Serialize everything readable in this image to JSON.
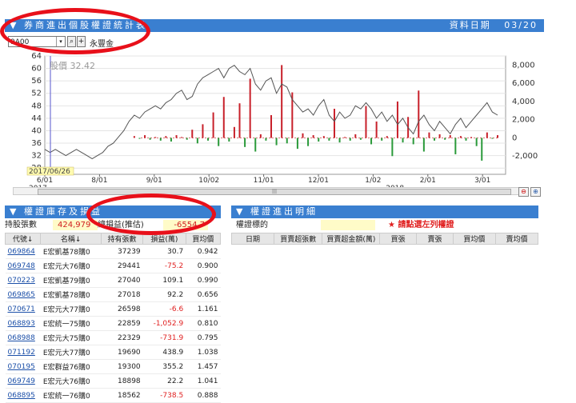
{
  "top_panel": {
    "title": "券商進出個股權證統計表",
    "date_label": "資料日期",
    "date_value": "03/20"
  },
  "search": {
    "value": "9A00",
    "dropdown_glyph": "▾",
    "search_glyph": "⌕",
    "add_glyph": "+",
    "stock_name": "永豐金"
  },
  "chart_overlay": {
    "price_label": "股價 32.42",
    "cursor_date": "2017/06/26"
  },
  "scroll_label": "|||",
  "chart_data": {
    "type": "line",
    "x_labels": [
      "6/01",
      "8/01",
      "9/01",
      "10/02",
      "11/01",
      "12/01",
      "1/02",
      "2/01",
      "3/01"
    ],
    "year_labels": [
      "2017",
      "2018"
    ],
    "left_axis": {
      "ticks": [
        28,
        32,
        36,
        40,
        44,
        48,
        52,
        56,
        60,
        64
      ],
      "range": [
        26,
        64
      ]
    },
    "right_axis": {
      "ticks": [
        "8,000",
        "6,000",
        "4,000",
        "2,000",
        "0",
        "-2,000"
      ],
      "range": [
        -4000,
        9000
      ]
    },
    "series": [
      {
        "values": [
          34,
          33,
          34,
          33,
          32,
          33,
          34,
          33,
          32,
          31,
          32,
          33,
          35,
          36,
          38,
          40,
          43,
          45,
          44,
          46,
          47,
          48,
          47,
          49,
          50,
          52,
          53,
          50,
          51,
          55,
          57,
          58,
          59,
          60,
          57,
          60,
          61,
          59,
          58,
          60,
          55,
          53,
          56,
          57,
          52,
          55,
          54,
          50,
          48,
          46,
          47,
          45,
          48,
          50,
          45,
          43,
          46,
          44,
          45,
          48,
          47,
          49,
          47,
          44,
          46,
          43,
          45,
          42,
          44,
          41,
          39,
          43,
          45,
          42,
          40,
          43,
          41,
          39,
          42,
          44,
          41,
          43,
          45,
          47,
          49,
          46,
          45
        ]
      },
      {
        "values": [
          0,
          0,
          0,
          0,
          0,
          0,
          0,
          0,
          0,
          0,
          0,
          0,
          0,
          0,
          0,
          0,
          0,
          200,
          -100,
          300,
          -200,
          100,
          -300,
          200,
          -400,
          300,
          100,
          -200,
          900,
          -600,
          1500,
          -300,
          2800,
          -900,
          4500,
          -400,
          1200,
          3800,
          -1000,
          6500,
          -1500,
          400,
          -300,
          2500,
          -800,
          8000,
          -600,
          5000,
          -1200,
          500,
          -900,
          300,
          -400,
          200,
          -300,
          3200,
          -500,
          100,
          -300,
          400,
          -200,
          3500,
          -700,
          1800,
          -300,
          200,
          -2000,
          4000,
          -500,
          2300,
          -700,
          5200,
          -1500,
          600,
          -300,
          400,
          -200,
          300,
          -1800,
          200,
          -300,
          100,
          -900,
          -2500,
          600,
          -100,
          300
        ]
      }
    ]
  },
  "inventory_panel": {
    "title": "權證庫存及損益",
    "holding_label": "持股張數",
    "holding_value": "424,979",
    "pnl_label": "總損益(推估)",
    "pnl_value": "-6554.7",
    "columns": [
      "代號↓",
      "名稱↓",
      "持有張數",
      "損益(萬)",
      "買均價"
    ],
    "rows": [
      [
        "069864",
        "E宏凱基78購0",
        "37239",
        "30.7",
        "0.942"
      ],
      [
        "069748",
        "E宏元大76購0",
        "29441",
        "-75.2",
        "0.900"
      ],
      [
        "070223",
        "E宏凱基79購0",
        "27040",
        "109.1",
        "0.990"
      ],
      [
        "069865",
        "E宏凱基78購0",
        "27018",
        "92.2",
        "0.656"
      ],
      [
        "070671",
        "E宏元大77購0",
        "26598",
        "-6.6",
        "1.161"
      ],
      [
        "068893",
        "E宏統一75購0",
        "22859",
        "-1,052.9",
        "0.810"
      ],
      [
        "068988",
        "E宏元大75購0",
        "22329",
        "-731.9",
        "0.795"
      ],
      [
        "071192",
        "E宏元大77購0",
        "19690",
        "438.9",
        "1.038"
      ],
      [
        "070195",
        "E宏群益76購0",
        "19300",
        "355.2",
        "1.457"
      ],
      [
        "069749",
        "E宏元大76購0",
        "18898",
        "22.2",
        "1.041"
      ],
      [
        "068895",
        "E宏統一76購0",
        "18562",
        "-738.5",
        "0.888"
      ]
    ]
  },
  "detail_panel": {
    "title": "權證進出明細",
    "target_label": "權證標的",
    "hint": "★ 請點選左列權證",
    "columns": [
      "日期",
      "買賣超張數",
      "買賣超金額(萬)",
      "買張",
      "賣張",
      "買均價",
      "賣均價"
    ]
  },
  "colors": {
    "header_blue": "#3a7fd0",
    "up_red": "#c8202a",
    "down_green": "#2a9a3a",
    "annotation_red": "#e8101a"
  }
}
